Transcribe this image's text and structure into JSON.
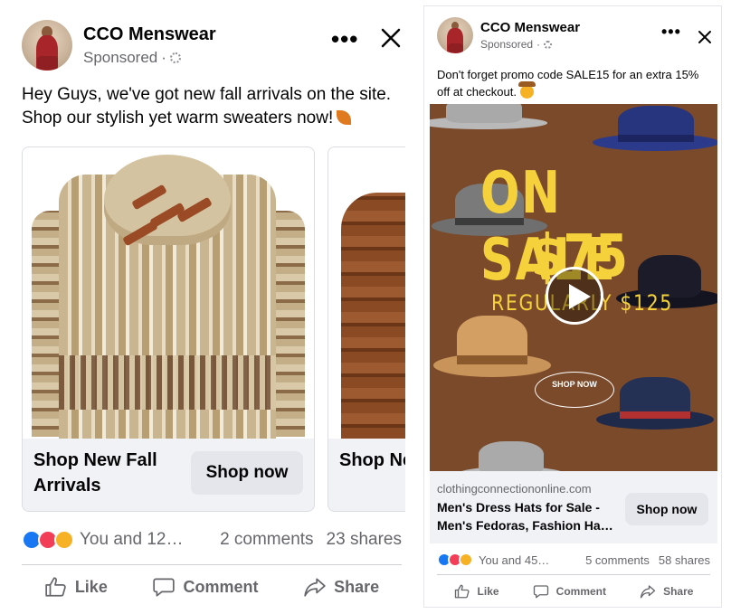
{
  "left_post": {
    "page_name": "CCO Menswear",
    "sponsored": "Sponsored",
    "more": "•••",
    "caption": "Hey Guys, we've got new fall arrivals on the site. Shop our stylish yet warm sweaters now!",
    "cards": [
      {
        "title": "Shop New Fall Arrivals",
        "cta": "Shop now"
      },
      {
        "title": "Shop New Fall Arrivals"
      }
    ],
    "reactions_text": "You and 12…",
    "comments": "2 comments",
    "shares": "23 shares",
    "actions": {
      "like": "Like",
      "comment": "Comment",
      "share": "Share"
    }
  },
  "right_post": {
    "page_name": "CCO Menswear",
    "sponsored": "Sponsored",
    "more": "•••",
    "caption": "Don't forget promo code SALE15 for an extra 15% off at checkout.",
    "video": {
      "headline": "ON SALE",
      "price": "$75",
      "regular": "REGULARLY $125",
      "shop": "SHOP NOW"
    },
    "link": {
      "domain": "clothingconnectiononline.com",
      "title": "Men's Dress Hats for Sale - Men's Fedoras, Fashion Ha…",
      "cta": "Shop now"
    },
    "reactions_text": "You and 45…",
    "comments": "5 comments",
    "shares": "58 shares",
    "actions": {
      "like": "Like",
      "comment": "Comment",
      "share": "Share"
    }
  },
  "colors": {
    "like_blue": "#1877f2",
    "love_red": "#f33e58",
    "haha_yellow": "#f7b125",
    "sale_yellow": "#f5d23b",
    "video_bg": "#7a4a2a"
  }
}
